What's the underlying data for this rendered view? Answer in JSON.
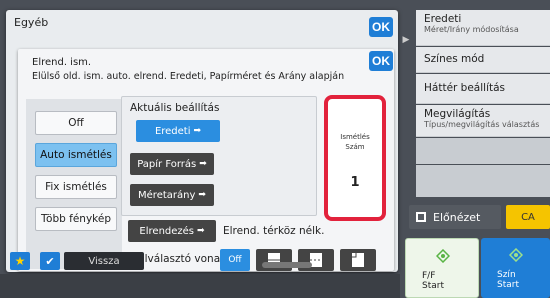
{
  "outer": {
    "title": "Egyéb",
    "ok_label": "OK"
  },
  "dialog": {
    "title": "Elrend. ism.",
    "ok_label": "OK",
    "description": "Elülső old. ism. auto. elrend. Eredeti, Papírméret és Arány alapján"
  },
  "modes": {
    "items": [
      {
        "label": "Off",
        "active": false
      },
      {
        "label": "Auto ismétlés",
        "active": true
      },
      {
        "label": "Fix ismétlés",
        "active": false
      },
      {
        "label": "Több fénykép",
        "active": false
      }
    ]
  },
  "settings": {
    "label": "Aktuális beállítás",
    "original_button": "Eredeti",
    "paper_button": "Papír Forrás",
    "ratio_button": "Méretarány"
  },
  "repeat": {
    "label_line1": "Ismétlés",
    "label_line2": "Szám",
    "value": "1"
  },
  "layout": {
    "button": "Elrendezés",
    "status": "Elrend. térköz nélk."
  },
  "separator": {
    "label": "Elválasztó vonal",
    "off_label": "Off"
  },
  "right_panel": {
    "items": [
      {
        "title": "Eredeti",
        "subtitle": "Méret/Irány módosítása"
      },
      {
        "title": "Színes mód",
        "subtitle": ""
      },
      {
        "title": "Háttér beállítás",
        "subtitle": ""
      },
      {
        "title": "Megvilágítás",
        "subtitle": "Típus/megvilágítás választás"
      }
    ],
    "preview_label": "Előnézet",
    "ca_label": "CA",
    "start_bw_line1": "F/F",
    "start_bw_line2": "Start",
    "start_color_line1": "Szín",
    "start_color_line2": "Start"
  },
  "bottom": {
    "back_label": "Vissza"
  },
  "colors": {
    "accent": "#1f7ed6",
    "active_mode": "#7cc1f0",
    "highlight": "#e2223c",
    "ca": "#f5c400"
  }
}
